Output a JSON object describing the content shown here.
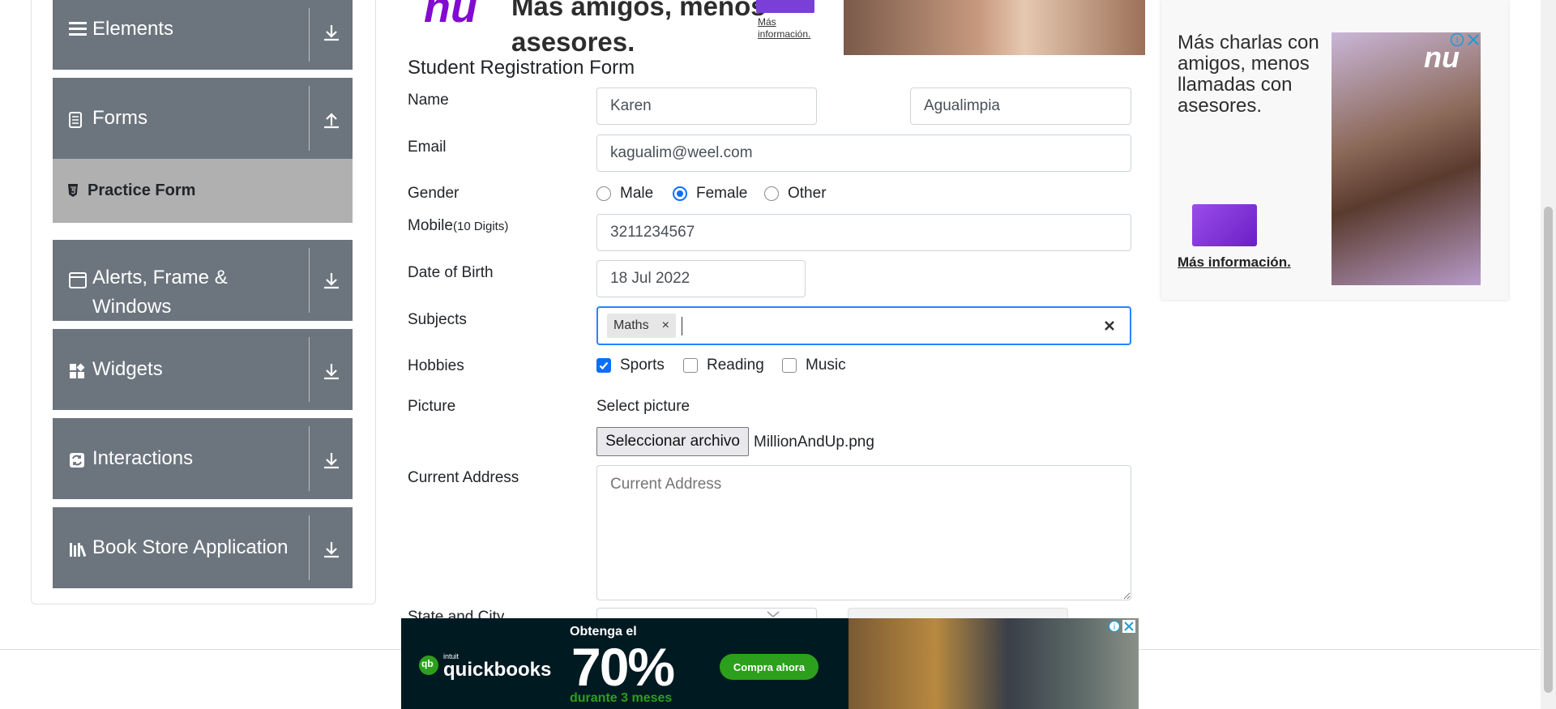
{
  "sidebar": {
    "groups": [
      {
        "label": "Elements",
        "icon": "menu-icon",
        "arrow": "download-arrow-icon"
      },
      {
        "label": "Forms",
        "icon": "document-icon",
        "arrow": "upload-arrow-icon"
      },
      {
        "label": "Alerts, Frame & Windows",
        "icon": "window-icon",
        "arrow": "download-arrow-icon"
      },
      {
        "label": "Widgets",
        "icon": "widgets-icon",
        "arrow": "download-arrow-icon"
      },
      {
        "label": "Interactions",
        "icon": "refresh-icon",
        "arrow": "download-arrow-icon"
      },
      {
        "label": "Book Store Application",
        "icon": "books-icon",
        "arrow": "download-arrow-icon"
      }
    ],
    "active_item": {
      "label": "Practice Form",
      "icon": "html5-icon"
    }
  },
  "ads": {
    "top": {
      "headline": "Más amigos, menos asesores.",
      "link": "Más información.",
      "brand": "nu"
    },
    "side": {
      "headline": "Más charlas con amigos, menos llamadas con asesores.",
      "link": "Más información.",
      "brand": "nu"
    },
    "bottom": {
      "brand": "quickbooks",
      "brand_prefix": "intuit",
      "line1": "Obtenga el",
      "big": "70%",
      "line2": "durante 3 meses",
      "cta": "Compra ahora"
    }
  },
  "form": {
    "title": "Student Registration Form",
    "labels": {
      "name": "Name",
      "email": "Email",
      "gender": "Gender",
      "mobile": "Mobile",
      "mobile_hint": "(10 Digits)",
      "dob": "Date of Birth",
      "subjects": "Subjects",
      "hobbies": "Hobbies",
      "picture": "Picture",
      "address": "Current Address",
      "state_city": "State and City"
    },
    "first_name": "Karen",
    "last_name": "Agualimpia",
    "email": "kagualim@weel.com",
    "gender_options": [
      "Male",
      "Female",
      "Other"
    ],
    "gender_selected": "Female",
    "mobile": "3211234567",
    "dob": "18 Jul 2022",
    "subjects": [
      "Maths"
    ],
    "hobbies": [
      {
        "label": "Sports",
        "checked": true
      },
      {
        "label": "Reading",
        "checked": false
      },
      {
        "label": "Music",
        "checked": false
      }
    ],
    "picture_label": "Select picture",
    "file_button": "Seleccionar archivo",
    "file_name": "MillionAndUp.png",
    "address_placeholder": "Current Address"
  },
  "colors": {
    "accent": "#0d6efd",
    "sidebar_bg": "#6c757d",
    "active_bg": "#b0b0b0",
    "nu_purple": "#820ad1",
    "qb_green": "#2ca01c"
  }
}
